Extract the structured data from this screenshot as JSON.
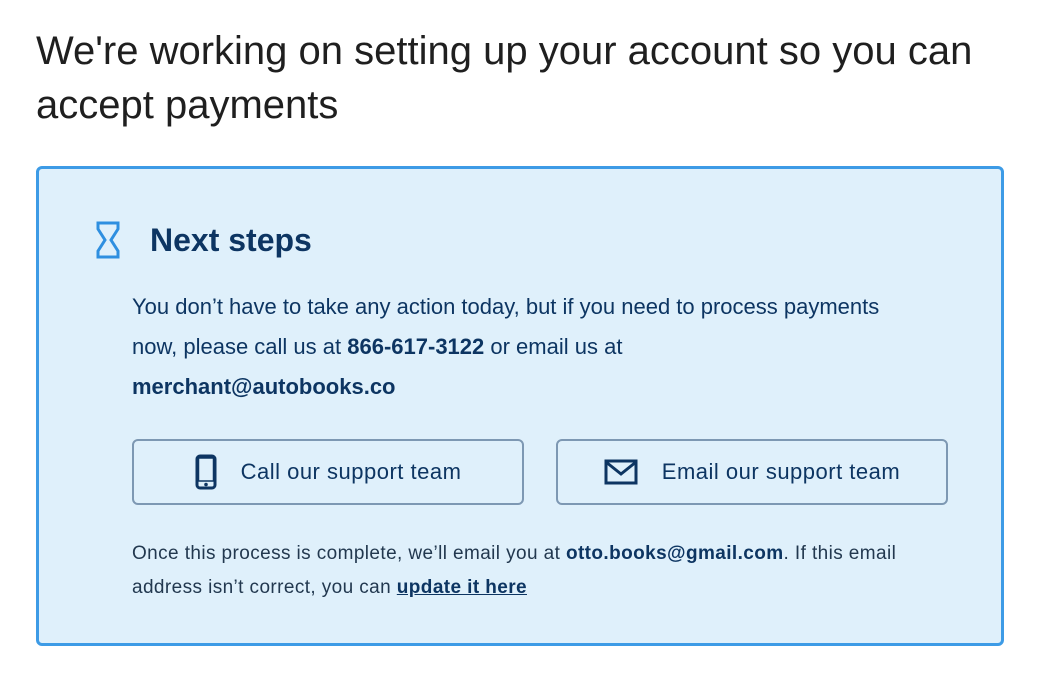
{
  "page": {
    "title": "We're working on setting up your account so you can accept payments"
  },
  "next_steps": {
    "icon": "hourglass-icon",
    "title": "Next steps",
    "message": {
      "part1": "You don’t have to take any action today, but if you need to process payments now, please call us at ",
      "phone": "866-617-3122",
      "part2": " or email us at ",
      "email": "merchant@autobooks.co"
    },
    "buttons": {
      "call": {
        "label": "Call our support team",
        "icon": "phone-icon"
      },
      "email": {
        "label": "Email our support team",
        "icon": "mail-icon"
      }
    },
    "footnote": {
      "part1": "Once this process is complete, we’ll email you at ",
      "email": "otto.books@gmail.com",
      "part2": ". If this email address isn’t correct, you can ",
      "link": "update it here"
    }
  },
  "colors": {
    "accent_border": "#3d9be6",
    "card_background": "#dff0fb",
    "text_primary": "#0d3562",
    "button_border": "#7d98b3"
  }
}
